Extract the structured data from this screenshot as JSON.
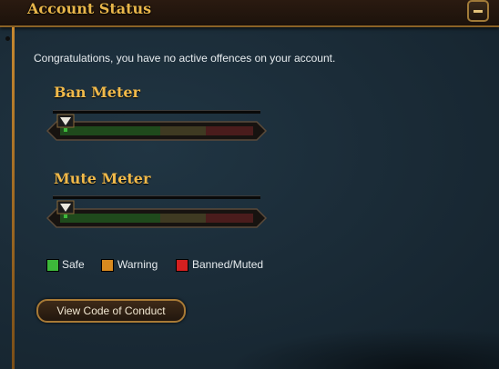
{
  "header": {
    "title": "Account Status",
    "collapse_icon": "minus-icon"
  },
  "message": "Congratulations, you have no active offences on your account.",
  "meters": [
    {
      "title": "Ban Meter",
      "level": 0
    },
    {
      "title": "Mute Meter",
      "level": 0
    }
  ],
  "legend": [
    {
      "label": "Safe",
      "color": "#3db83a"
    },
    {
      "label": "Warning",
      "color": "#d88a1f"
    },
    {
      "label": "Banned/Muted",
      "color": "#d42020"
    }
  ],
  "colors": {
    "accent": "#f0b94a",
    "track_safe": "#1f4a1c",
    "track_warning": "#3f3a22",
    "track_banned": "#4a1c1c",
    "pointer": "#e9e6dc"
  },
  "button": {
    "label": "View Code of Conduct"
  }
}
